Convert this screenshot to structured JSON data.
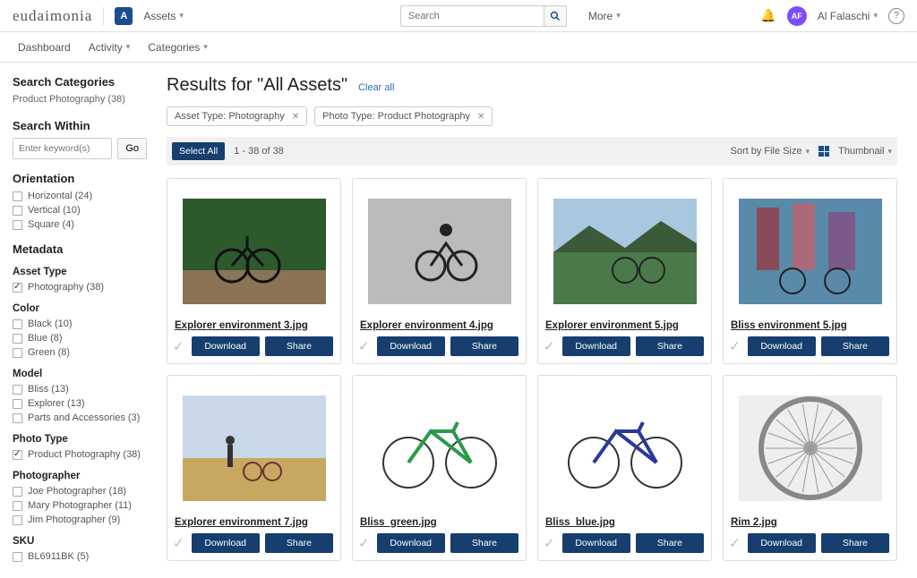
{
  "brand": "eudaimonia",
  "topNav": {
    "assets": "Assets",
    "searchPlaceholder": "Search",
    "more": "More",
    "userName": "Al Falaschi",
    "avatarInitials": "AF"
  },
  "subNav": {
    "dashboard": "Dashboard",
    "activity": "Activity",
    "categories": "Categories"
  },
  "sidebar": {
    "searchCategories": "Search Categories",
    "crumb": "Product Photography (38)",
    "searchWithin": "Search Within",
    "keywordPlaceholder": "Enter keyword(s)",
    "go": "Go",
    "orientation": {
      "title": "Orientation",
      "items": [
        {
          "label": "Horizontal (24)",
          "checked": false
        },
        {
          "label": "Vertical (10)",
          "checked": false
        },
        {
          "label": "Square (4)",
          "checked": false
        }
      ]
    },
    "metadata": "Metadata",
    "assetType": {
      "title": "Asset Type",
      "items": [
        {
          "label": "Photography (38)",
          "checked": true
        }
      ]
    },
    "color": {
      "title": "Color",
      "items": [
        {
          "label": "Black (10)",
          "checked": false
        },
        {
          "label": "Blue (8)",
          "checked": false
        },
        {
          "label": "Green (8)",
          "checked": false
        }
      ]
    },
    "model": {
      "title": "Model",
      "items": [
        {
          "label": "Bliss (13)",
          "checked": false
        },
        {
          "label": "Explorer (13)",
          "checked": false
        },
        {
          "label": "Parts and Accessories (3)",
          "checked": false
        }
      ]
    },
    "photoType": {
      "title": "Photo Type",
      "items": [
        {
          "label": "Product Photography (38)",
          "checked": true
        }
      ]
    },
    "photographer": {
      "title": "Photographer",
      "items": [
        {
          "label": "Joe Photographer (18)",
          "checked": false
        },
        {
          "label": "Mary Photographer (11)",
          "checked": false
        },
        {
          "label": "Jim Photographer (9)",
          "checked": false
        }
      ]
    },
    "sku": {
      "title": "SKU",
      "items": [
        {
          "label": "BL6911BK (5)",
          "checked": false
        }
      ]
    }
  },
  "results": {
    "titlePrefix": "Results for ",
    "titleQuery": "\"All Assets\"",
    "clearAll": "Clear all",
    "chips": [
      "Asset Type: Photography",
      "Photo Type: Product Photography"
    ],
    "selectAll": "Select All",
    "count": "1 - 38 of 38",
    "sort": "Sort by File Size",
    "viewLabel": "Thumbnail",
    "downloadLabel": "Download",
    "shareLabel": "Share",
    "cards": [
      {
        "name": "Explorer environment 3.jpg",
        "thumb": "forest"
      },
      {
        "name": "Explorer environment 4.jpg",
        "thumb": "bw"
      },
      {
        "name": "Explorer environment 5.jpg",
        "thumb": "coast"
      },
      {
        "name": "Bliss environment 5.jpg",
        "thumb": "city"
      },
      {
        "name": "Explorer environment 7.jpg",
        "thumb": "field"
      },
      {
        "name": "Bliss_green.jpg",
        "thumb": "green-bike"
      },
      {
        "name": "Bliss_blue.jpg",
        "thumb": "blue-bike"
      },
      {
        "name": "Rim 2.jpg",
        "thumb": "rim"
      }
    ]
  }
}
